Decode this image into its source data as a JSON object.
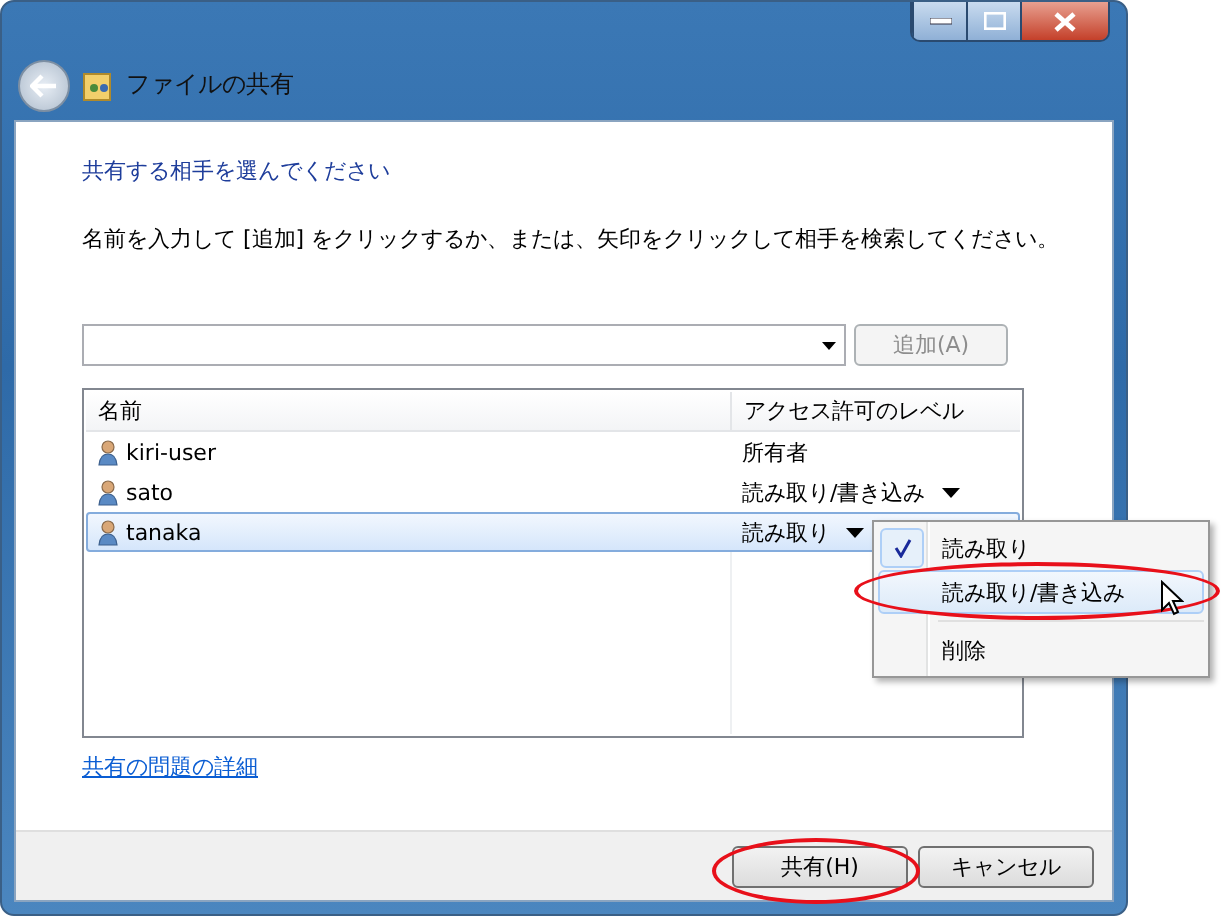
{
  "window": {
    "title": "ファイルの共有"
  },
  "heading": "共有する相手を選んでください",
  "instruction": "名前を入力して [追加] をクリックするか、または、矢印をクリックして相手を検索してください。",
  "add_button": {
    "label": "追加(A)",
    "disabled": true
  },
  "table": {
    "columns": [
      "名前",
      "アクセス許可のレベル"
    ],
    "rows": [
      {
        "name": "kiri-user",
        "access": "所有者",
        "dropdown": false,
        "selected": false
      },
      {
        "name": "sato",
        "access": "読み取り/書き込み",
        "dropdown": true,
        "selected": false
      },
      {
        "name": "tanaka",
        "access": "読み取り",
        "dropdown": true,
        "selected": true
      }
    ]
  },
  "menu": {
    "items": [
      {
        "kind": "option",
        "label": "読み取り",
        "checked": true,
        "selected": false,
        "highlighted": false
      },
      {
        "kind": "option",
        "label": "読み取り/書き込み",
        "checked": false,
        "selected": true,
        "highlighted": true
      },
      {
        "kind": "separator"
      },
      {
        "kind": "option",
        "label": "削除",
        "checked": false,
        "selected": false,
        "highlighted": false
      }
    ]
  },
  "link": "共有の問題の詳細",
  "buttons": [
    {
      "label": "共有(H)",
      "highlighted": true
    },
    {
      "label": "キャンセル",
      "highlighted": false
    }
  ]
}
